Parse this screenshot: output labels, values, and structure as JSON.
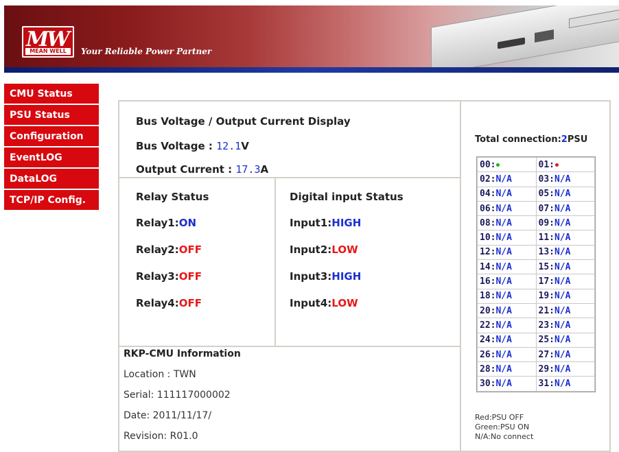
{
  "header": {
    "logo_mark": "MW",
    "logo_sub": "MEAN WELL",
    "tagline": "Your Reliable Power Partner"
  },
  "menu": [
    {
      "label": "CMU Status"
    },
    {
      "label": "PSU Status"
    },
    {
      "label": "Configuration"
    },
    {
      "label": "EventLOG"
    },
    {
      "label": "DataLOG"
    },
    {
      "label": "TCP/IP Config."
    }
  ],
  "bus": {
    "title": "Bus Voltage / Output Current Display",
    "voltage_label": "Bus Voltage : ",
    "voltage_value": "12.1",
    "voltage_unit": "V",
    "current_label": "Output Current : ",
    "current_value": "17.3",
    "current_unit": "A"
  },
  "relay": {
    "title": "Relay Status",
    "items": [
      {
        "label": "Relay1:",
        "state": "ON",
        "color": "#1d2fd0"
      },
      {
        "label": "Relay2:",
        "state": "OFF",
        "color": "#e81818"
      },
      {
        "label": "Relay3:",
        "state": "OFF",
        "color": "#e81818"
      },
      {
        "label": "Relay4:",
        "state": "OFF",
        "color": "#e81818"
      }
    ]
  },
  "digital": {
    "title": "Digital input Status",
    "items": [
      {
        "label": "Input1:",
        "state": "HIGH",
        "color": "#1d2fd0"
      },
      {
        "label": "Input2:",
        "state": "LOW",
        "color": "#e81818"
      },
      {
        "label": "Input3:",
        "state": "HIGH",
        "color": "#1d2fd0"
      },
      {
        "label": "Input4:",
        "state": "LOW",
        "color": "#e81818"
      }
    ]
  },
  "info": {
    "title": "RKP-CMU Information",
    "location": "Location : TWN",
    "serial": "Serial: 111117000002",
    "date": "Date: 2011/11/17/",
    "revision": "Revision: R01.0"
  },
  "connections": {
    "total_label": "Total connection:",
    "total_count": "2",
    "total_unit": "PSU",
    "rows": [
      [
        {
          "id": "00:",
          "state": "",
          "dot": "#22aa22"
        },
        {
          "id": "01:",
          "state": "",
          "dot": "#e81818"
        }
      ],
      [
        {
          "id": "02:",
          "state": "N/A"
        },
        {
          "id": "03:",
          "state": "N/A"
        }
      ],
      [
        {
          "id": "04:",
          "state": "N/A"
        },
        {
          "id": "05:",
          "state": "N/A"
        }
      ],
      [
        {
          "id": "06:",
          "state": "N/A"
        },
        {
          "id": "07:",
          "state": "N/A"
        }
      ],
      [
        {
          "id": "08:",
          "state": "N/A"
        },
        {
          "id": "09:",
          "state": "N/A"
        }
      ],
      [
        {
          "id": "10:",
          "state": "N/A"
        },
        {
          "id": "11:",
          "state": "N/A"
        }
      ],
      [
        {
          "id": "12:",
          "state": "N/A"
        },
        {
          "id": "13:",
          "state": "N/A"
        }
      ],
      [
        {
          "id": "14:",
          "state": "N/A"
        },
        {
          "id": "15:",
          "state": "N/A"
        }
      ],
      [
        {
          "id": "16:",
          "state": "N/A"
        },
        {
          "id": "17:",
          "state": "N/A"
        }
      ],
      [
        {
          "id": "18:",
          "state": "N/A"
        },
        {
          "id": "19:",
          "state": "N/A"
        }
      ],
      [
        {
          "id": "20:",
          "state": "N/A"
        },
        {
          "id": "21:",
          "state": "N/A"
        }
      ],
      [
        {
          "id": "22:",
          "state": "N/A"
        },
        {
          "id": "23:",
          "state": "N/A"
        }
      ],
      [
        {
          "id": "24:",
          "state": "N/A"
        },
        {
          "id": "25:",
          "state": "N/A"
        }
      ],
      [
        {
          "id": "26:",
          "state": "N/A"
        },
        {
          "id": "27:",
          "state": "N/A"
        }
      ],
      [
        {
          "id": "28:",
          "state": "N/A"
        },
        {
          "id": "29:",
          "state": "N/A"
        }
      ],
      [
        {
          "id": "30:",
          "state": "N/A"
        },
        {
          "id": "31:",
          "state": "N/A"
        }
      ]
    ],
    "legend": [
      "Red:PSU OFF",
      "Green:PSU ON",
      "N/A:No connect"
    ]
  }
}
